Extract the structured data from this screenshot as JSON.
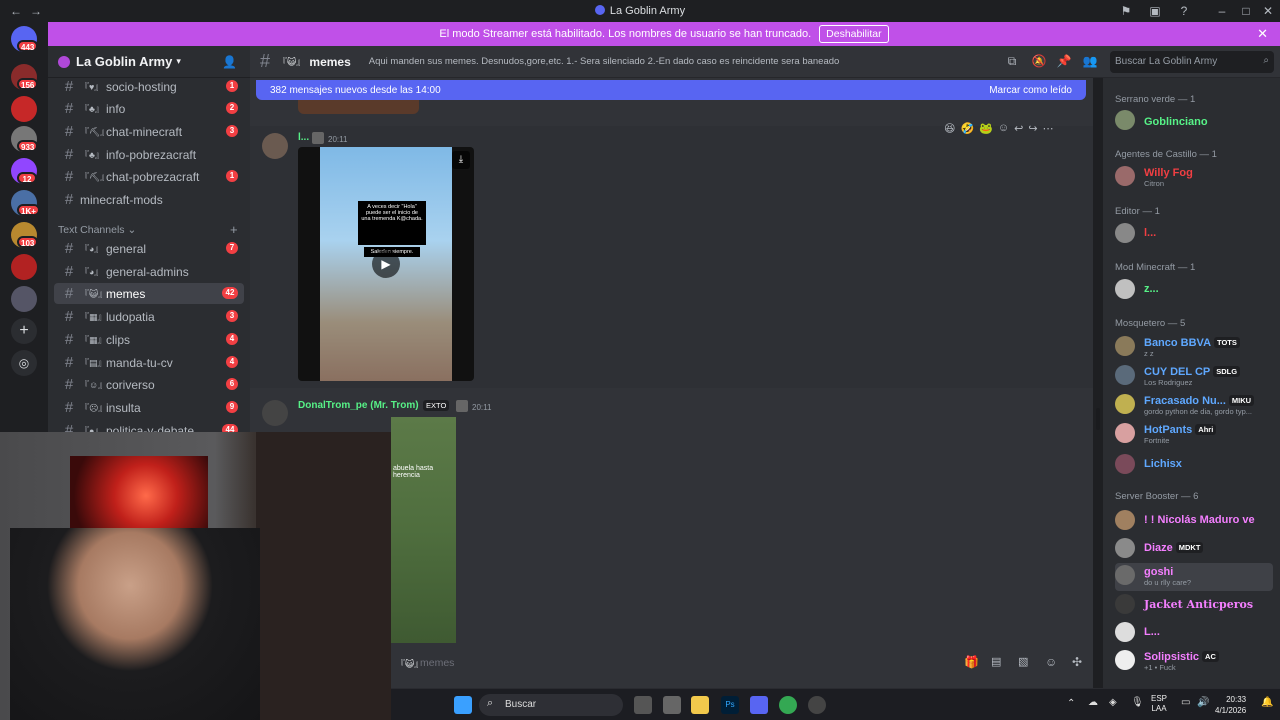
{
  "window": {
    "title": "La Goblin Army"
  },
  "banner": {
    "text": "El modo Streamer está habilitado. Los nombres de usuario se han truncado.",
    "button": "Deshabilitar"
  },
  "guilds": {
    "badges": [
      "443",
      "156",
      "933",
      "12",
      "1K+",
      "103"
    ]
  },
  "server": {
    "name": "La Goblin Army"
  },
  "channels": [
    {
      "name": "socio-hosting",
      "badge": "1"
    },
    {
      "name": "info",
      "badge": "2"
    },
    {
      "name": "chat-minecraft",
      "badge": "3"
    },
    {
      "name": "info-pobrezacraft",
      "badge": ""
    },
    {
      "name": "chat-pobrezacraft",
      "badge": "1"
    },
    {
      "name": "minecraft-mods",
      "badge": ""
    }
  ],
  "text_category": "Text Channels",
  "text_channels": [
    {
      "name": "general",
      "badge": "7"
    },
    {
      "name": "general-admins",
      "badge": ""
    },
    {
      "name": "memes",
      "badge": "42"
    },
    {
      "name": "ludopatia",
      "badge": "3"
    },
    {
      "name": "clips",
      "badge": "4"
    },
    {
      "name": "manda-tu-cv",
      "badge": "4"
    },
    {
      "name": "coriverso",
      "badge": "6"
    },
    {
      "name": "insulta",
      "badge": "9"
    },
    {
      "name": "politica-y-debate",
      "badge": "44"
    }
  ],
  "header": {
    "channel": "memes",
    "topic": "Aqui manden sus memes. Desnudos,gore,etc. 1.- Sera silenciado 2.-En dado caso es reincidente sera baneado",
    "search_placeholder": "Buscar La Goblin Army"
  },
  "new_messages": {
    "text": "382 mensajes nuevos desde las 14:00",
    "mark_read": "Marcar como leído"
  },
  "messages": [
    {
      "author": "l...",
      "time": "20:11",
      "video_caption": "A veces decir \"Hola\" puede ser el inicio de una tremenda K@chada.",
      "video_caption2": "Saluden siempre."
    },
    {
      "author": "DonalTrom_pe (Mr. Trom)",
      "tag": "EXTO",
      "time": "20:11",
      "image_caption": "abuela hasta herencia"
    }
  ],
  "composer": {
    "placeholder": "memes"
  },
  "members": {
    "categories": [
      {
        "title": "Serrano verde — 1"
      },
      {
        "title": "Agentes de Castillo — 1"
      },
      {
        "title": "Editor — 1"
      },
      {
        "title": "Mod Minecraft — 1"
      },
      {
        "title": "Mosquetero — 5"
      },
      {
        "title": "Server Booster — 6"
      }
    ],
    "list": [
      {
        "name": "Goblinciano",
        "status": "",
        "color": "#57f287"
      },
      {
        "name": "Willy Fog",
        "status": "Citron",
        "color": "#f23f43"
      },
      {
        "name": "l...",
        "status": "",
        "color": "#f23f43"
      },
      {
        "name": "z...",
        "status": "",
        "color": "#57f287"
      },
      {
        "name": "Banco BBVA",
        "tag": "TOTS",
        "status": "z z",
        "color": "#5fa8ff"
      },
      {
        "name": "CUY DEL CP",
        "tag": "SDLG",
        "status": "Los Rodriguez",
        "color": "#5fa8ff"
      },
      {
        "name": "Fracasado Nu...",
        "tag": "MIKU",
        "status": "gordo python de dia, gordo typ...",
        "color": "#5fa8ff"
      },
      {
        "name": "HotPants",
        "tag": "Ahri",
        "status": "Fortnite",
        "color": "#5fa8ff"
      },
      {
        "name": "Lichisx",
        "status": "",
        "color": "#5fa8ff"
      },
      {
        "name": "! ! Nicolás Maduro ve",
        "status": "",
        "color": "#f47fff"
      },
      {
        "name": "Diaze",
        "tag": "MDKT",
        "status": "",
        "color": "#f47fff"
      },
      {
        "name": "goshi",
        "status": "do u rlly care?",
        "color": "#f47fff"
      },
      {
        "name": "Jacket Anticperos",
        "status": "",
        "color": "#f47fff"
      },
      {
        "name": "L...",
        "status": "",
        "color": "#f47fff"
      },
      {
        "name": "Solipsistic",
        "tag": "AC",
        "status": "+1 • Fuck",
        "color": "#f47fff"
      }
    ]
  },
  "taskbar": {
    "search": "Buscar",
    "lang1": "ESP",
    "lang2": "LAA",
    "time": "20:33",
    "date": "4/1/2026"
  }
}
